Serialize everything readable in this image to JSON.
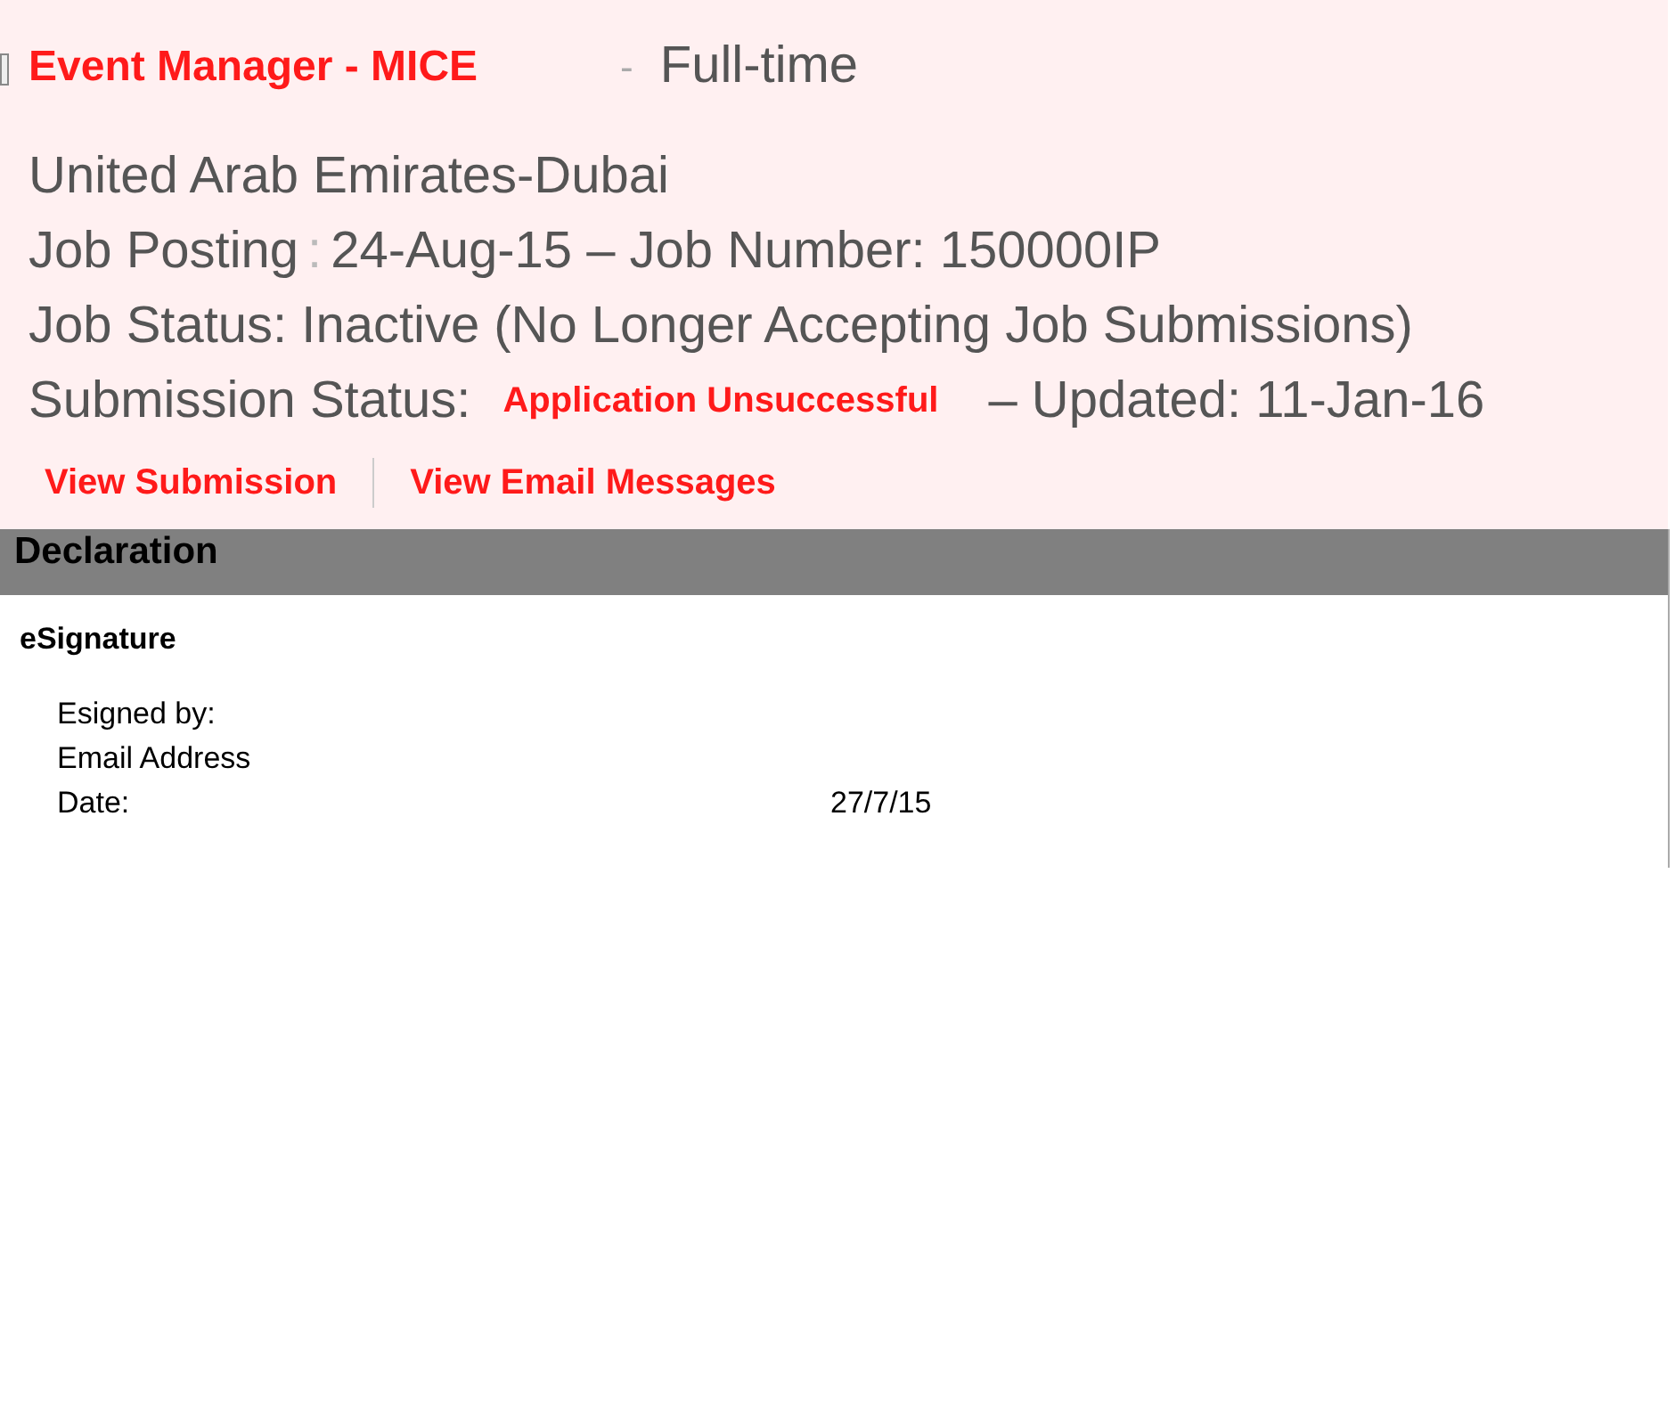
{
  "job": {
    "title": "Event Manager - MICE",
    "separator": "-",
    "type": "Full-time",
    "location": "United Arab Emirates-Dubai",
    "posting_label": "Job Posting",
    "posting_colon": ":",
    "posting_date": "24-Aug-15 – Job Number: 150000IP",
    "status": "Job Status: Inactive (No Longer Accepting Job Submissions)",
    "submission_label": "Submission Status:",
    "submission_value": "Application Unsuccessful",
    "updated": "– Updated: 11-Jan-16"
  },
  "links": [
    "View Submission",
    "View Email Messages"
  ],
  "declaration": {
    "header": "Declaration",
    "subtitle": "eSignature",
    "rows": [
      {
        "label": "Esigned by:"
      },
      {
        "label": "Email Address"
      },
      {
        "label": "Date:",
        "value": "27/7/15"
      }
    ]
  }
}
